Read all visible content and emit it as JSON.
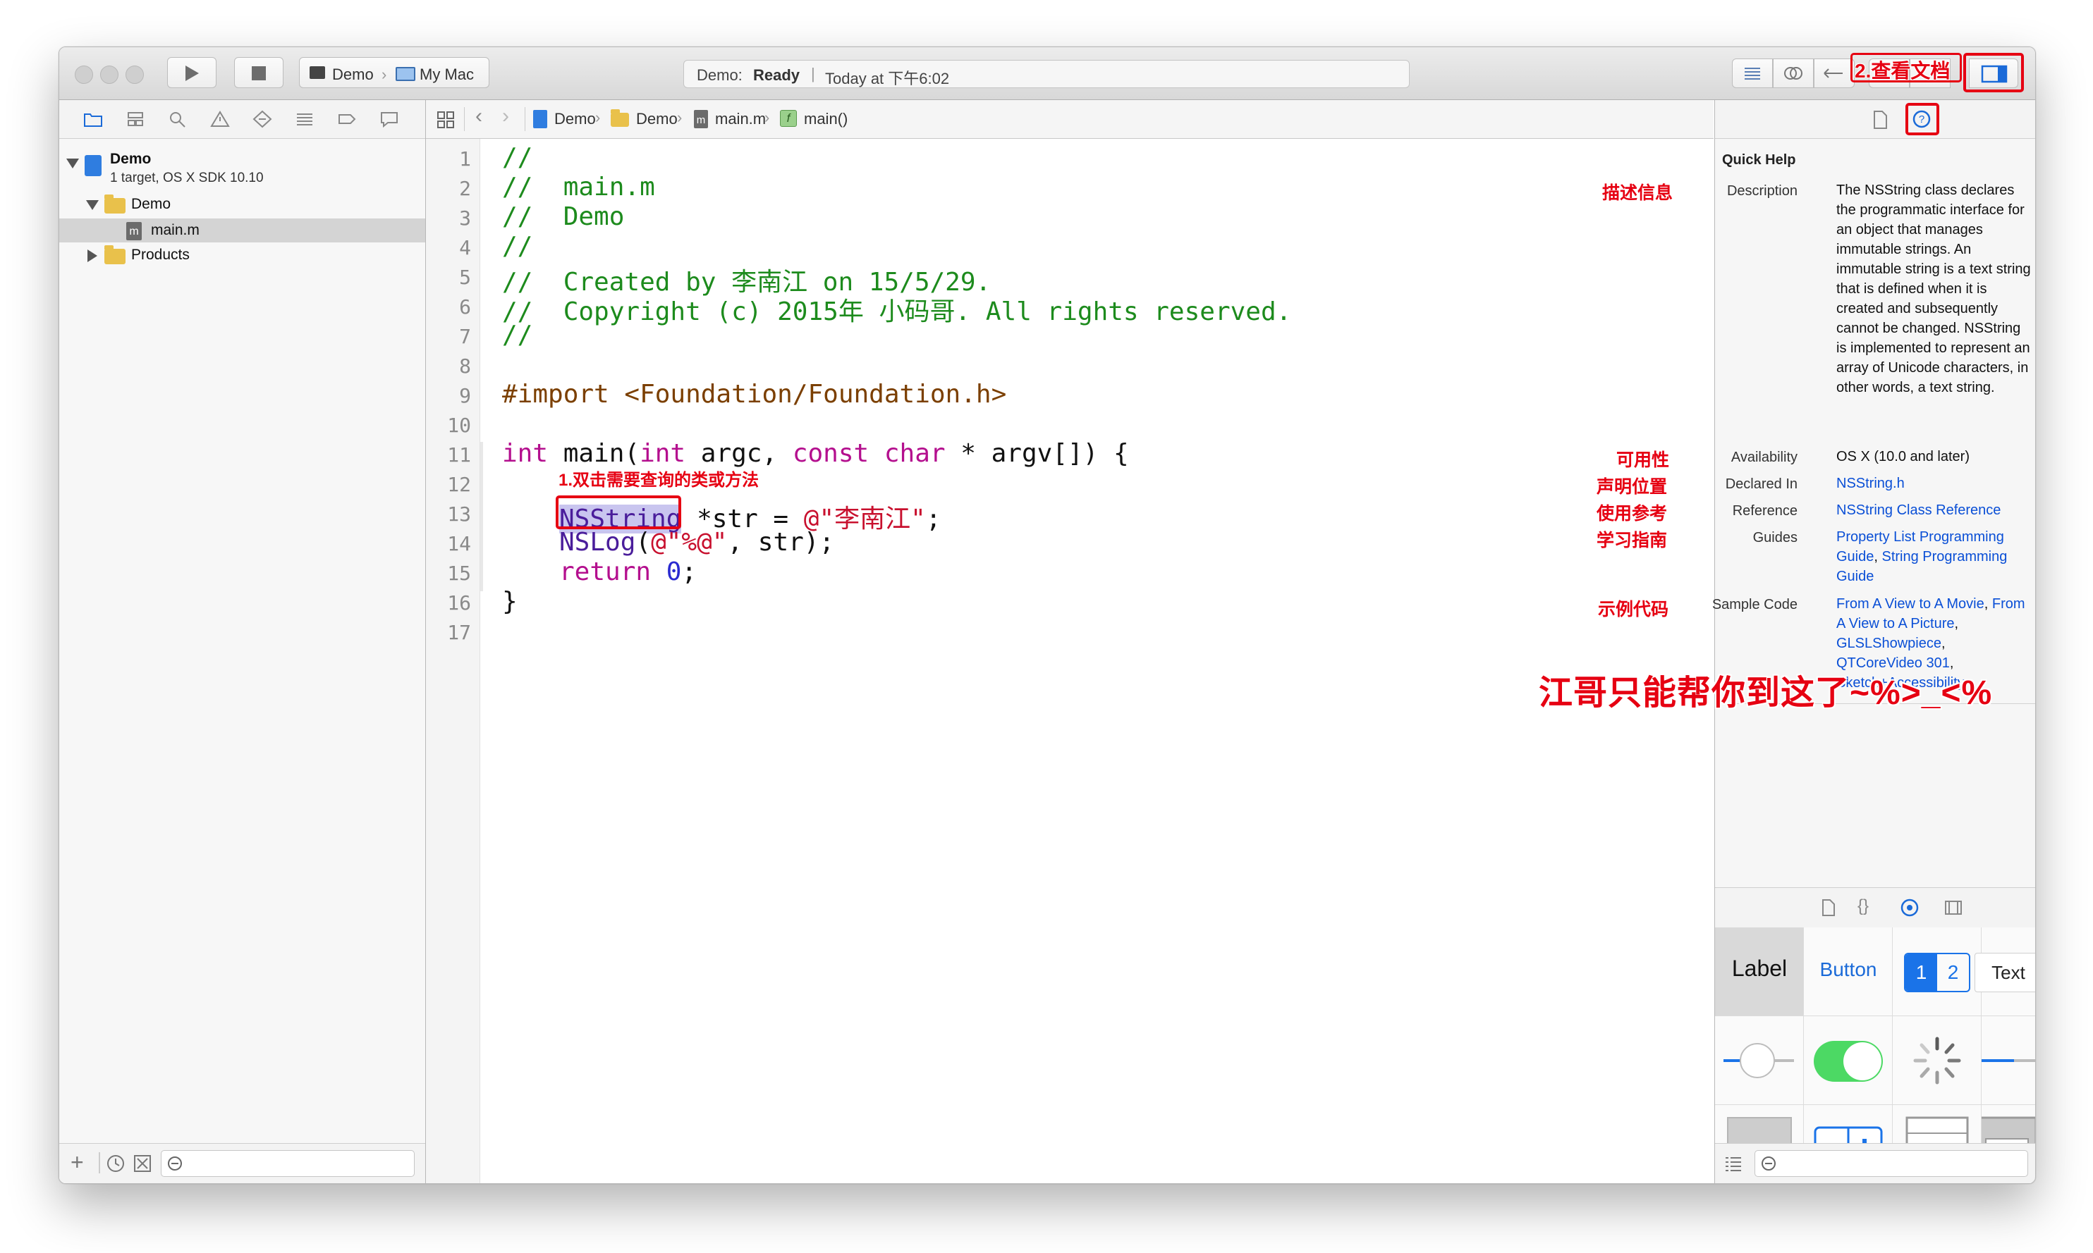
{
  "toolbar": {
    "scheme_target": "Demo",
    "scheme_device": "My Mac",
    "status_project": "Demo:",
    "status_state": "Ready",
    "status_time": "Today at 下午6:02",
    "annotation_view_docs": "2.查看文档"
  },
  "navigator": {
    "project_name": "Demo",
    "project_subtitle": "1 target, OS X SDK 10.10",
    "group_demo": "Demo",
    "file_main": "main.m",
    "group_products": "Products"
  },
  "jumpbar": {
    "crumbs": [
      "Demo",
      "Demo",
      "main.m",
      "main()"
    ]
  },
  "code": {
    "line_numbers": [
      "1",
      "2",
      "3",
      "4",
      "5",
      "6",
      "7",
      "8",
      "9",
      "10",
      "11",
      "12",
      "13",
      "14",
      "15",
      "16",
      "17"
    ],
    "l1": "//",
    "l2": "//  main.m",
    "l3": "//  Demo",
    "l4": "//",
    "l5": "//  Created by 李南江 on 15/5/29.",
    "l6": "//  Copyright (c) 2015年 小码哥. All rights reserved.",
    "l7": "//",
    "l9": "#import <Foundation/Foundation.h>",
    "l11_kw1": "int",
    "l11_a": " main(",
    "l11_kw2": "int",
    "l11_b": " argc, ",
    "l11_kw3": "const char",
    "l11_c": " * argv[]) {",
    "l13_cls": "NSString",
    "l13_a": " *str = ",
    "l13_str": "@\"李南江\"",
    "l13_b": ";",
    "l14_fn": "NSLog",
    "l14_a": "(",
    "l14_str": "@\"%@\"",
    "l14_b": ", str);",
    "l15_kw": "return",
    "l15_num": "0",
    "l15_b": ";",
    "l16": "}",
    "annotation_double_click": "1.双击需要查询的类或方法"
  },
  "quick_help": {
    "title": "Quick Help",
    "description_label": "Description",
    "description": "The NSString class declares the programmatic interface for an object that manages immutable strings. An immutable string is a text string that is defined when it is created and subsequently cannot be changed. NSString is implemented to represent an array of Unicode characters, in other words, a text string.",
    "availability_label": "Availability",
    "availability": "OS X (10.0 and later)",
    "declared_label": "Declared In",
    "declared": "NSString.h",
    "reference_label": "Reference",
    "reference": "NSString Class Reference",
    "guides_label": "Guides",
    "guides_1": "Property List Programming Guide",
    "guides_sep": ", ",
    "guides_2": "String Programming Guide",
    "sample_label": "Sample Code",
    "sample_1": "From A View to A Movie",
    "sample_2": "From A View to A Picture",
    "sample_3": "GLSLShowpiece",
    "sample_4": "QTCoreVideo 301",
    "sample_5": "Sketch+Accessibility",
    "sep": ", ",
    "ann_description": "描述信息",
    "ann_availability": "可用性",
    "ann_declared": "声明位置",
    "ann_reference": "使用参考",
    "ann_guides": "学习指南",
    "ann_sample": "示例代码",
    "ann_big": "江哥只能帮你到这了~%>_<%"
  },
  "library": {
    "label_item": "Label",
    "button_item": "Button",
    "seg_1": "1",
    "seg_2": "2",
    "text_item": "Text"
  },
  "colors": {
    "annotation_red": "#e60012",
    "comment_green": "#1d8b1d",
    "keyword_purple": "#b40f8e",
    "string_red": "#c8102e",
    "link_blue": "#0a4fd6",
    "switch_green": "#4cd964",
    "selection_blue": "#1a73e8"
  }
}
